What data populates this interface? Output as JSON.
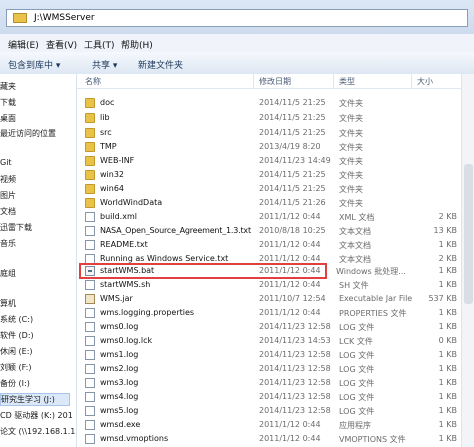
{
  "address": {
    "path": "J:\\WMSServer"
  },
  "menu": [
    {
      "label": "编辑(E)"
    },
    {
      "label": "查看(V)"
    },
    {
      "label": "工具(T)"
    },
    {
      "label": "帮助(H)"
    }
  ],
  "toolbar": [
    {
      "label": "包含到库中 ▾"
    },
    {
      "label": "共享 ▾"
    },
    {
      "label": "新建文件夹"
    }
  ],
  "sidebar": [
    {
      "label": "藏夹"
    },
    {
      "label": "下载"
    },
    {
      "label": "桌面"
    },
    {
      "label": "最近访问的位置"
    },
    {
      "label": "Git"
    },
    {
      "label": "视频"
    },
    {
      "label": "图片"
    },
    {
      "label": "文档"
    },
    {
      "label": "迅雷下载"
    },
    {
      "label": "音乐"
    },
    {
      "label": "庭组"
    },
    {
      "label": "算机"
    },
    {
      "label": "系统 (C:)"
    },
    {
      "label": "软件 (D:)"
    },
    {
      "label": "休闲 (E:)"
    },
    {
      "label": "刘颖 (F:)"
    },
    {
      "label": "备份 (I:)"
    },
    {
      "label": "研究生学习 (J:)"
    },
    {
      "label": "CD 驱动器 (K:) 201"
    },
    {
      "label": "论文 (\\\\192.168.1.1"
    }
  ],
  "columns": {
    "name": "名称",
    "date": "修改日期",
    "type": "类型",
    "size": "大小"
  },
  "files": [
    {
      "name": "doc",
      "date": "2014/11/5 21:25",
      "type": "文件夹",
      "size": "",
      "icon": "folder-icon"
    },
    {
      "name": "lib",
      "date": "2014/11/5 21:25",
      "type": "文件夹",
      "size": "",
      "icon": "folder-icon"
    },
    {
      "name": "src",
      "date": "2014/11/5 21:25",
      "type": "文件夹",
      "size": "",
      "icon": "folder-icon"
    },
    {
      "name": "TMP",
      "date": "2013/4/19 8:20",
      "type": "文件夹",
      "size": "",
      "icon": "folder-icon"
    },
    {
      "name": "WEB-INF",
      "date": "2014/11/23 14:49",
      "type": "文件夹",
      "size": "",
      "icon": "folder-icon"
    },
    {
      "name": "win32",
      "date": "2014/11/5 21:25",
      "type": "文件夹",
      "size": "",
      "icon": "folder-icon"
    },
    {
      "name": "win64",
      "date": "2014/11/5 21:25",
      "type": "文件夹",
      "size": "",
      "icon": "folder-icon"
    },
    {
      "name": "WorldWindData",
      "date": "2014/11/5 21:26",
      "type": "文件夹",
      "size": "",
      "icon": "folder-icon"
    },
    {
      "name": "build.xml",
      "date": "2011/1/12 0:44",
      "type": "XML 文档",
      "size": "2 KB",
      "icon": "xml-file-icon"
    },
    {
      "name": "NASA_Open_Source_Agreement_1.3.txt",
      "date": "2010/8/18 10:25",
      "type": "文本文档",
      "size": "13 KB",
      "icon": "text-file-icon"
    },
    {
      "name": "README.txt",
      "date": "2011/1/12 0:44",
      "type": "文本文档",
      "size": "1 KB",
      "icon": "text-file-icon"
    },
    {
      "name": "Running as Windows Service.txt",
      "date": "2011/1/12 0:44",
      "type": "文本文档",
      "size": "2 KB",
      "icon": "text-file-icon"
    },
    {
      "name": "startWMS.bat",
      "date": "2011/1/12 0:44",
      "type": "Windows 批处理...",
      "size": "1 KB",
      "icon": "batch-file-icon",
      "highlight": true
    },
    {
      "name": "startWMS.sh",
      "date": "2011/1/12 0:44",
      "type": "SH 文件",
      "size": "1 KB",
      "icon": "file-icon"
    },
    {
      "name": "WMS.jar",
      "date": "2011/10/7 12:54",
      "type": "Executable Jar File",
      "size": "537 KB",
      "icon": "jar-file-icon"
    },
    {
      "name": "wms.logging.properties",
      "date": "2011/1/12 0:44",
      "type": "PROPERTIES 文件",
      "size": "1 KB",
      "icon": "file-icon"
    },
    {
      "name": "wms0.log",
      "date": "2014/11/23 12:58",
      "type": "LOG 文件",
      "size": "1 KB",
      "icon": "file-icon"
    },
    {
      "name": "wms0.log.lck",
      "date": "2014/11/23 14:53",
      "type": "LCK 文件",
      "size": "0 KB",
      "icon": "file-icon"
    },
    {
      "name": "wms1.log",
      "date": "2014/11/23 12:58",
      "type": "LOG 文件",
      "size": "1 KB",
      "icon": "file-icon"
    },
    {
      "name": "wms2.log",
      "date": "2014/11/23 12:58",
      "type": "LOG 文件",
      "size": "1 KB",
      "icon": "file-icon"
    },
    {
      "name": "wms3.log",
      "date": "2014/11/23 12:58",
      "type": "LOG 文件",
      "size": "1 KB",
      "icon": "file-icon"
    },
    {
      "name": "wms4.log",
      "date": "2014/11/23 12:58",
      "type": "LOG 文件",
      "size": "1 KB",
      "icon": "file-icon"
    },
    {
      "name": "wms5.log",
      "date": "2014/11/23 12:58",
      "type": "LOG 文件",
      "size": "1 KB",
      "icon": "file-icon"
    },
    {
      "name": "wmsd.exe",
      "date": "2011/1/12 0:44",
      "type": "应用程序",
      "size": "1 KB",
      "icon": "executable-icon"
    },
    {
      "name": "wmsd.vmoptions",
      "date": "2011/1/12 0:44",
      "type": "VMOPTIONS 文件",
      "size": "1 KB",
      "icon": "file-icon"
    }
  ]
}
